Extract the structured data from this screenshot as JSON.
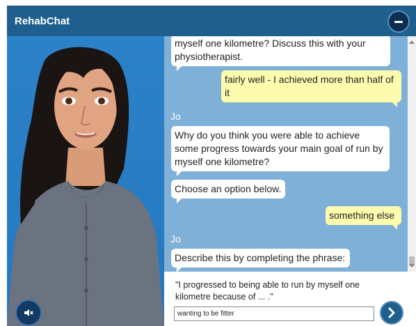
{
  "header": {
    "title": "RehabChat"
  },
  "messages": [
    {
      "role": "bot",
      "text": "myself one kilometre? Discuss this with your physiotherapist."
    },
    {
      "role": "user",
      "text": "fairly well - I achieved more than half of it"
    },
    {
      "sender": "Jo"
    },
    {
      "role": "bot",
      "text": "Why do you think you were able to achieve some progress towards your main goal of run by myself one kilometre?"
    },
    {
      "role": "bot",
      "text": "Choose an option below."
    },
    {
      "role": "user",
      "text": "something else"
    },
    {
      "sender": "Jo"
    },
    {
      "role": "bot",
      "text": "Describe this by completing the phrase:"
    }
  ],
  "composer": {
    "prompt": "\"I progressed to being able to run by myself one kilometre because of ... .\"",
    "input_value": "wanting to be fitter"
  },
  "icons": {
    "minimize": "minimize-icon",
    "mute": "speaker-muted-icon",
    "send": "chevron-right-icon"
  },
  "colors": {
    "header": "#1f5f8d",
    "chat_bg": "#7fb0d8",
    "bot_bubble": "#ffffff",
    "user_bubble": "#fdfcae",
    "avatar_bg": "#2478c0"
  }
}
